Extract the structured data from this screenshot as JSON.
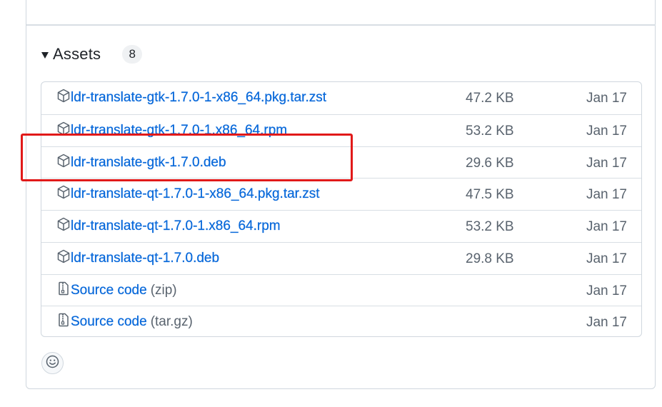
{
  "assets": {
    "title": "Assets",
    "count": "8",
    "items": [
      {
        "name": "ldr-translate-gtk-1.7.0-1-x86_64.pkg.tar.zst",
        "suffix": "",
        "size": "47.2 KB",
        "date": "Jan 17",
        "icon": "package-icon"
      },
      {
        "name": "ldr-translate-gtk-1.7.0-1.x86_64.rpm",
        "suffix": "",
        "size": "53.2 KB",
        "date": "Jan 17",
        "icon": "package-icon"
      },
      {
        "name": "ldr-translate-gtk-1.7.0.deb",
        "suffix": "",
        "size": "29.6 KB",
        "date": "Jan 17",
        "icon": "package-icon"
      },
      {
        "name": "ldr-translate-qt-1.7.0-1-x86_64.pkg.tar.zst",
        "suffix": "",
        "size": "47.5 KB",
        "date": "Jan 17",
        "icon": "package-icon"
      },
      {
        "name": "ldr-translate-qt-1.7.0-1.x86_64.rpm",
        "suffix": "",
        "size": "53.2 KB",
        "date": "Jan 17",
        "icon": "package-icon"
      },
      {
        "name": "ldr-translate-qt-1.7.0.deb",
        "suffix": "",
        "size": "29.8 KB",
        "date": "Jan 17",
        "icon": "package-icon"
      },
      {
        "name": "Source code",
        "suffix": "(zip)",
        "size": "",
        "date": "Jan 17",
        "icon": "file-zip-icon"
      },
      {
        "name": "Source code",
        "suffix": "(tar.gz)",
        "size": "",
        "date": "Jan 17",
        "icon": "file-zip-icon"
      }
    ]
  },
  "highlight": {
    "color": "#e11919"
  },
  "reactions": {
    "icon": "smiley-icon"
  },
  "colors": {
    "link": "#0969da",
    "muted": "#59636e",
    "border": "#d0d7de"
  }
}
